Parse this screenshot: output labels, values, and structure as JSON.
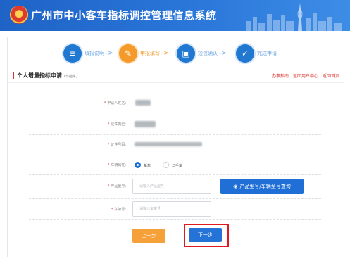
{
  "app": {
    "title": "广州市中小客车指标调控管理信息系统"
  },
  "steps": [
    {
      "label": "填报说明",
      "icon": "list-icon",
      "state": "done"
    },
    {
      "label": "申报填写",
      "icon": "edit-icon",
      "state": "current"
    },
    {
      "label": "短信确认",
      "icon": "sms-icon",
      "state": "todo"
    },
    {
      "label": "完成申请",
      "icon": "document-check-icon",
      "state": "todo"
    }
  ],
  "section": {
    "title": "个人增量指标申请",
    "subtitle": "(节能车)",
    "links": [
      "办事指南",
      "返回用户中心",
      "返回首页"
    ]
  },
  "form": {
    "applicant_name_label": "申请人姓名:",
    "id_type_label": "证件类型:",
    "id_number_label": "证件号码:",
    "vehicle_type_label": "车辆属性:",
    "vehicle_options": [
      "新车",
      "二手车"
    ],
    "vehicle_selected": "新车",
    "product_model_label": "产品型号:",
    "product_model_placeholder": "请输入产品型号",
    "product_query_button": "产品型号/车辆型号查询",
    "vin_label": "车架号:",
    "vin_placeholder": "请输入车架号"
  },
  "actions": {
    "prev": "上一步",
    "next": "下一步"
  },
  "colors": {
    "header": "#1f63c6",
    "primary": "#1f6fd6",
    "accent": "#f39a2b",
    "highlight": "#e0191f"
  }
}
